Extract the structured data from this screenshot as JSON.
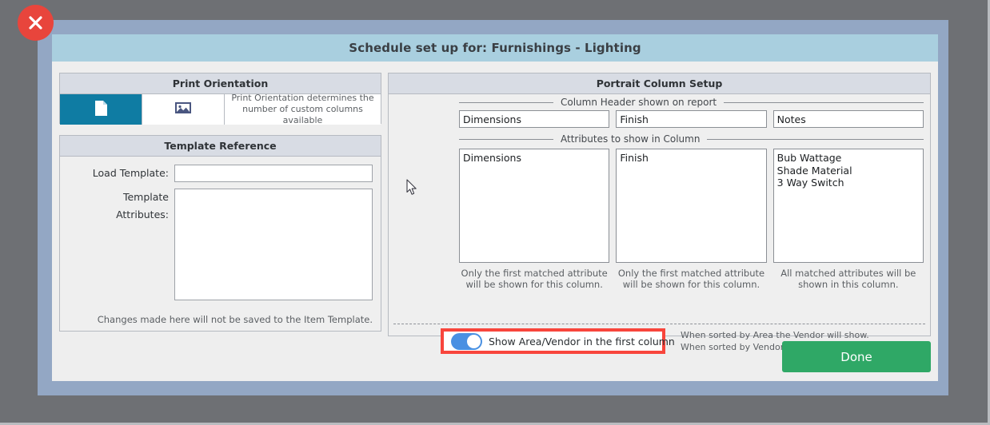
{
  "dialog": {
    "title": "Schedule set up for: Furnishings - Lighting",
    "close_icon": "close-x-icon"
  },
  "print_orientation": {
    "header": "Print Orientation",
    "options": [
      {
        "icon": "portrait-page-icon",
        "selected": true
      },
      {
        "icon": "landscape-image-icon",
        "selected": false
      }
    ],
    "hint_line1": "Print Orientation determines the",
    "hint_line2": "number of custom columns available"
  },
  "template_reference": {
    "header": "Template Reference",
    "load_template_label": "Load Template:",
    "load_template_value": "",
    "load_template_placeholder": "",
    "template_attributes_label": "Template Attributes:",
    "template_attributes_value": "",
    "template_attributes_placeholder": "",
    "note": "Changes made here will not be saved to the Item Template."
  },
  "portrait_column_setup": {
    "header": "Portrait Column Setup",
    "column_header_legend": "Column Header shown on report",
    "attributes_legend": "Attributes to show in Column",
    "columns": [
      {
        "header_value": "Dimensions",
        "attributes": [
          "Dimensions"
        ],
        "note_line1": "Only the first matched attribute",
        "note_line2": "will be shown for this column."
      },
      {
        "header_value": "Finish",
        "attributes": [
          "Finish"
        ],
        "note_line1": "Only the first matched attribute",
        "note_line2": "will be shown for this column."
      },
      {
        "header_value": "Notes",
        "attributes": [
          "Bub Wattage",
          "Shade Material",
          "3 Way Switch"
        ],
        "note_line1": "All matched attributes will be",
        "note_line2": "shown in this column."
      }
    ],
    "toggle": {
      "label": "Show Area/Vendor in the first column",
      "on": true,
      "help_line1": "When sorted by Area the Vendor will show.",
      "help_line2": "When sorted by Vendor the Area will show."
    }
  },
  "footer": {
    "done_label": "Done"
  },
  "colors": {
    "title_bar": "#a9cfdf",
    "modal_backdrop": "#93a7c4",
    "page_background": "#6e7074",
    "group_header": "#d8dce4",
    "selected_orientation": "#0f7ca3",
    "toggle_on": "#4a90e2",
    "highlight_border": "#f8453c",
    "done_button": "#2fa866",
    "close_button": "#e8453c"
  }
}
